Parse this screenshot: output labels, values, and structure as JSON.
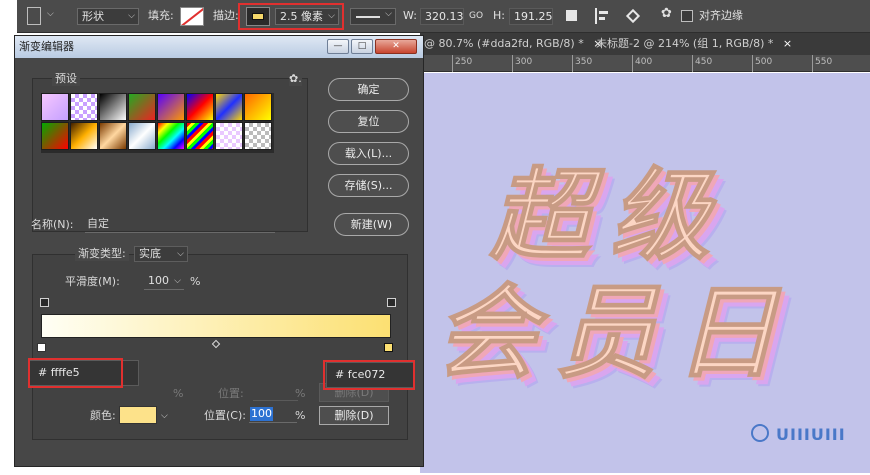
{
  "options_bar": {
    "mode_label": "形状",
    "fill_label": "填充:",
    "stroke_label": "描边:",
    "stroke_width": "2.5 像素",
    "w_label": "W:",
    "w_value": "320.13",
    "link_icon": "GO",
    "h_label": "H:",
    "h_value": "191.25",
    "align_edges_label": "对齐边缘"
  },
  "doc_tabs": [
    {
      "label": "@ 80.7% (#dda2fd, RGB/8) *",
      "close": "×"
    },
    {
      "label": "未标题-2 @ 214% (组 1, RGB/8) *",
      "close": "×"
    }
  ],
  "ruler_labels": [
    "250",
    "300",
    "350",
    "400",
    "450",
    "500",
    "550"
  ],
  "canvas": {
    "title_line1": [
      "超",
      "级"
    ],
    "title_line2": [
      "会",
      "员",
      "日"
    ],
    "watermark": "UIIIUIII"
  },
  "dialog": {
    "title": "渐变编辑器",
    "window_buttons": [
      "—",
      "□",
      "✕"
    ],
    "presets_label": "预设",
    "gear_icon": "✿.",
    "buttons": {
      "ok": "确定",
      "reset": "复位",
      "load": "载入(L)...",
      "save": "存储(S)...",
      "new": "新建(W)"
    },
    "name_label": "名称(N):",
    "name_value": "自定",
    "gradient_type_label": "渐变类型:",
    "gradient_type_value": "实底",
    "smoothness_label": "平滑度(M):",
    "smoothness_value": "100",
    "smoothness_unit": "%",
    "gradient_start_color": "#fffff5",
    "gradient_end_color": "#fce072",
    "hex_left": "# ffffe5",
    "hex_right": "# fce072",
    "opacity_unit": "%",
    "opacity_position_label": "位置:",
    "opacity_position_unit": "%",
    "delete_disabled": "删除(D)",
    "color_label": "颜色:",
    "color_value": "#fde28a",
    "position_label": "位置(C):",
    "position_value": "100",
    "position_unit": "%",
    "delete_label": "删除(D)"
  }
}
